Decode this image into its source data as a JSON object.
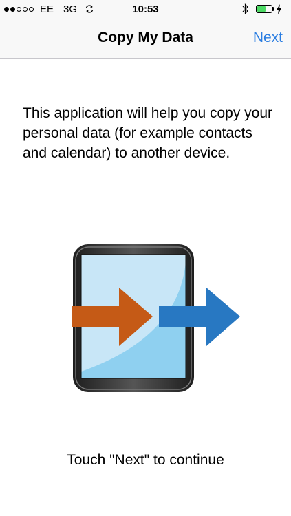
{
  "status_bar": {
    "signal_dots": [
      true,
      true,
      false,
      false,
      false
    ],
    "carrier": "EE",
    "network": "3G",
    "sync_icon": "sync-icon",
    "time": "10:53",
    "bluetooth_icon": "bluetooth-icon",
    "battery_level": 0.6,
    "battery_color": "#4cd964",
    "charge_icon": "charging-bolt-icon"
  },
  "nav": {
    "title": "Copy My Data",
    "next_label": "Next",
    "accent_color": "#2a7de1"
  },
  "content": {
    "intro": "This application will help you copy your personal data (for example contacts and calendar) to another device.",
    "illustration_icon": "phone-transfer-icon",
    "footer": "Touch \"Next\" to continue"
  }
}
